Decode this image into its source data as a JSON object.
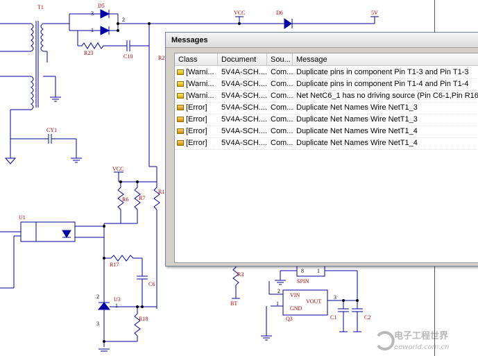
{
  "panel": {
    "title": "Messages",
    "columns": [
      "Class",
      "Document",
      "Sou...",
      "Message"
    ],
    "rows": [
      {
        "class": "[Warni...",
        "document": "5V4A-SCH....",
        "source": "Com...",
        "message": "Duplicate pins in component Pin T1-3 and Pin T1-3",
        "type": "warning"
      },
      {
        "class": "[Warni...",
        "document": "5V4A-SCH....",
        "source": "Com...",
        "message": "Duplicate pins in component Pin T1-4 and Pin T1-4",
        "type": "warning"
      },
      {
        "class": "[Warni...",
        "document": "5V4A-SCH....",
        "source": "Com...",
        "message": "Net NetC6_1 has no driving source (Pin C6-1,Pin R16-1,",
        "type": "warning"
      },
      {
        "class": "[Error]",
        "document": "5V4A-SCH....",
        "source": "Com...",
        "message": "Duplicate Net Names Wire NetT1_3",
        "type": "error"
      },
      {
        "class": "[Error]",
        "document": "5V4A-SCH....",
        "source": "Com...",
        "message": "Duplicate Net Names Wire NetT1_3",
        "type": "error"
      },
      {
        "class": "[Error]",
        "document": "5V4A-SCH....",
        "source": "Com...",
        "message": "Duplicate Net Names Wire NetT1_4",
        "type": "error"
      },
      {
        "class": "[Error]",
        "document": "5V4A-SCH....",
        "source": "Com...",
        "message": "Duplicate Net Names Wire NetT1_4",
        "type": "error"
      }
    ]
  },
  "schematic": {
    "labels": {
      "t1": "T1",
      "d5": "D5",
      "d6": "D6",
      "vcc_top": "VCC",
      "v5": "5V",
      "r23": "R23",
      "c10": "C10",
      "r2": "R2",
      "cy1": "CY1",
      "vcc_mid": "VCC",
      "r6": "R6",
      "r7": "R7",
      "r1": "R1",
      "u1": "U1",
      "r17": "R17",
      "c6": "C6",
      "u3": "U3",
      "r18": "R18",
      "r3": "R3",
      "bt": "BT",
      "spin": "SPIN",
      "q3": "Q3",
      "vin": "VIN",
      "gnd": "GND",
      "vout": "VOUT",
      "c1": "C1",
      "c2": "C2"
    },
    "pins": {
      "p3": "3",
      "p1": "1",
      "p2": "2",
      "u3p2": "2",
      "u3p1": "1",
      "u3p3": "3",
      "sp8": "8",
      "sp1": "1",
      "q2": "2",
      "q1": "1",
      "q3pin": "3"
    }
  },
  "watermark": {
    "cn": "电子工程世界",
    "en": "eeworld.com.cn"
  }
}
